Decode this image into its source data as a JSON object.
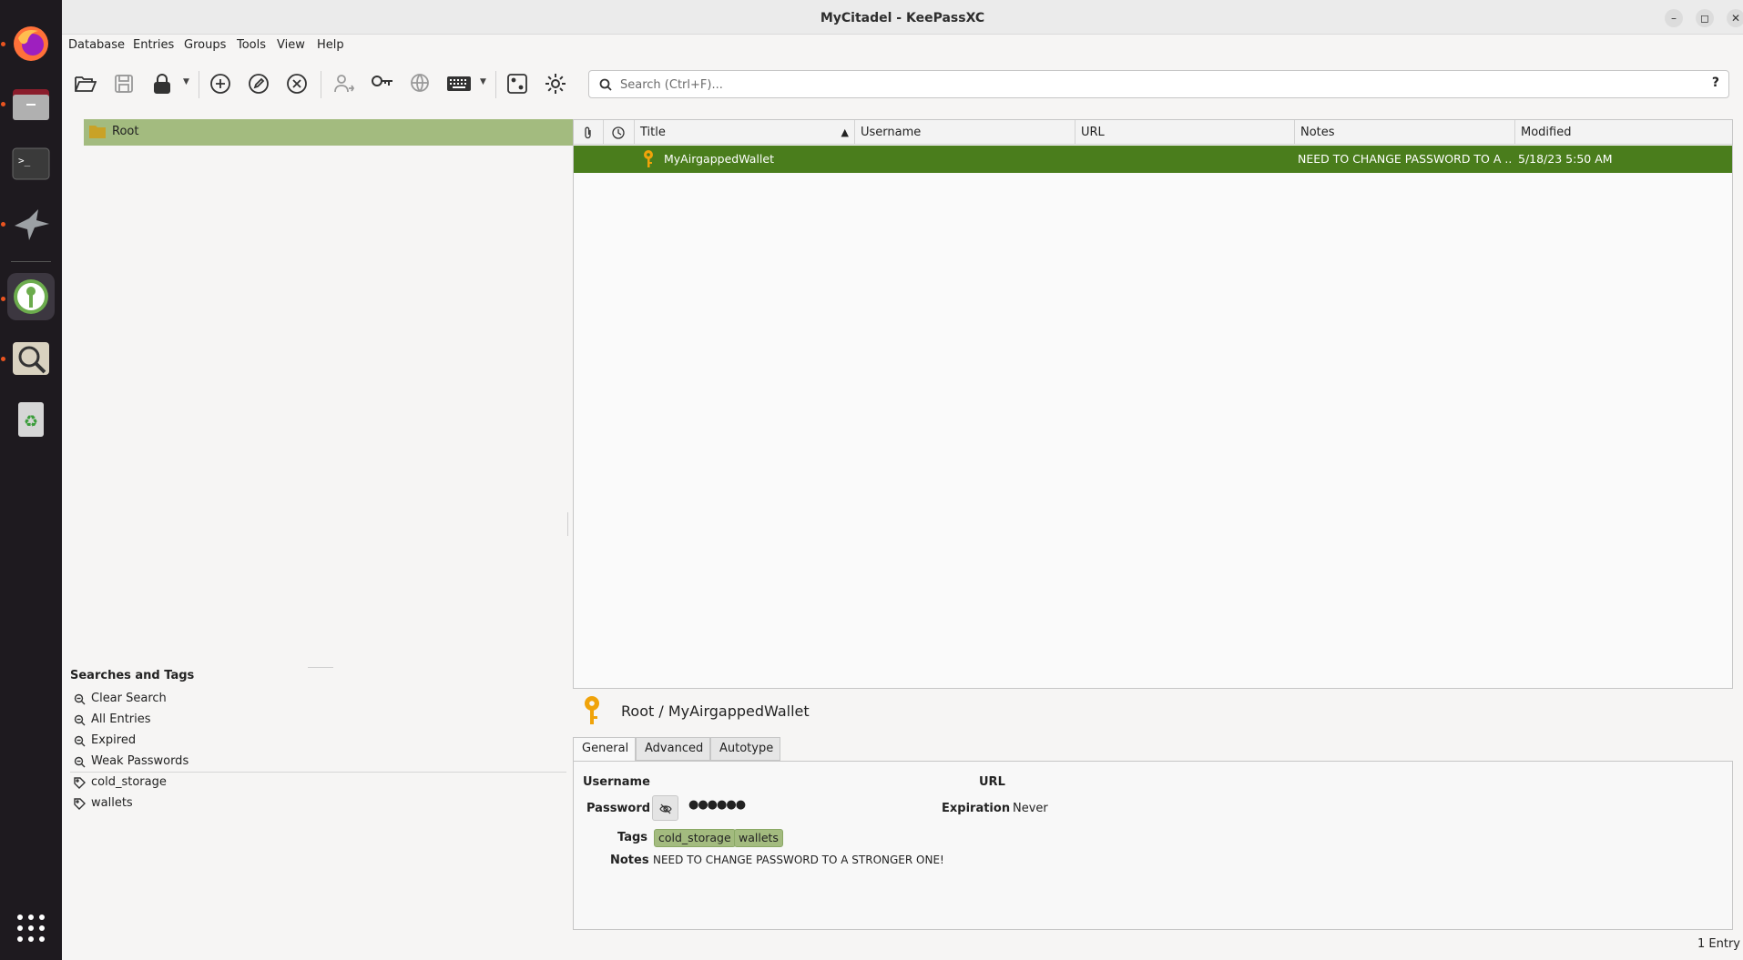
{
  "window": {
    "title": "MyCitadel - KeePassXC"
  },
  "menu": [
    "Database",
    "Entries",
    "Groups",
    "Tools",
    "View",
    "Help"
  ],
  "search": {
    "placeholder": "Search (Ctrl+F)...",
    "help": "?"
  },
  "groups": {
    "root": "Root"
  },
  "tags_panel": {
    "title": "Searches and Tags",
    "searches": [
      "Clear Search",
      "All Entries",
      "Expired",
      "Weak Passwords"
    ],
    "tags": [
      "cold_storage",
      "wallets"
    ]
  },
  "table": {
    "columns": {
      "title": "Title",
      "username": "Username",
      "url": "URL",
      "notes": "Notes",
      "modified": "Modified"
    },
    "rows": [
      {
        "title": "MyAirgappedWallet",
        "username": "",
        "url": "",
        "notes": "NEED TO CHANGE PASSWORD TO A ...",
        "modified": "5/18/23 5:50 AM"
      }
    ]
  },
  "preview": {
    "title": "Root / MyAirgappedWallet",
    "tabs": [
      "General",
      "Advanced",
      "Autotype"
    ],
    "labels": {
      "username": "Username",
      "password": "Password",
      "tags": "Tags",
      "notes": "Notes",
      "url": "URL",
      "expiration": "Expiration"
    },
    "password_mask": "●●●●●●",
    "expiration": "Never",
    "tags": [
      "cold_storage",
      "wallets"
    ],
    "notes": "NEED TO CHANGE PASSWORD TO A STRONGER ONE!"
  },
  "status": {
    "text": "1 Entry"
  },
  "colors": {
    "selection": "#4a7d1c",
    "group_highlight": "#a3bb7f",
    "accent": "#e95420"
  }
}
